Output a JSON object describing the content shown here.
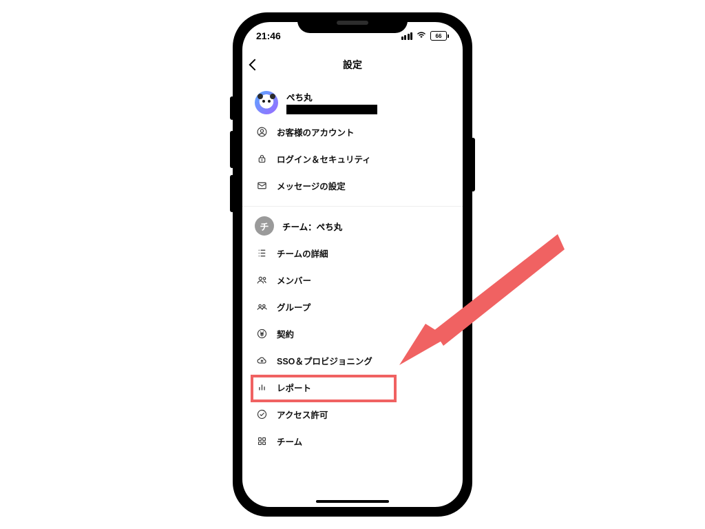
{
  "status": {
    "time": "21:46",
    "battery_text": "66"
  },
  "nav": {
    "title": "設定"
  },
  "profile": {
    "name": "ぺち丸"
  },
  "section1": {
    "items": [
      {
        "label": "お客様のアカウント"
      },
      {
        "label": "ログイン＆セキュリティ"
      },
      {
        "label": "メッセージの設定"
      }
    ]
  },
  "team": {
    "badge": "チ",
    "header": "チーム：ぺち丸",
    "items": [
      {
        "label": "チームの詳細"
      },
      {
        "label": "メンバー"
      },
      {
        "label": "グループ"
      },
      {
        "label": "契約"
      },
      {
        "label": "SSO＆プロビジョニング"
      },
      {
        "label": "レポート"
      },
      {
        "label": "アクセス許可"
      },
      {
        "label": "チーム"
      }
    ]
  },
  "annotation": {
    "arrow_color": "#f06262",
    "highlight_color": "#f06262",
    "highlighted_item_index": 3
  }
}
